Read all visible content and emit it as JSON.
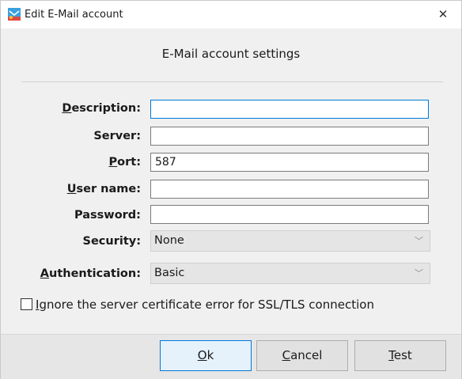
{
  "window": {
    "title": "Edit E-Mail account",
    "close_glyph": "✕",
    "app_icon": "mail-app-icon"
  },
  "heading": "E-Mail account settings",
  "form": {
    "description": {
      "label_u": "D",
      "label_rest": "escription:",
      "value": ""
    },
    "server": {
      "label": "Server:",
      "value": ""
    },
    "port": {
      "label_u": "P",
      "label_rest": "ort:",
      "value": "587"
    },
    "user_name": {
      "label_u": "U",
      "label_rest": "ser name:",
      "value": ""
    },
    "password": {
      "label": "Password:",
      "value": ""
    },
    "security": {
      "label": "Security:",
      "selected": "None"
    },
    "authentication": {
      "label_u": "A",
      "label_rest": "uthentication:",
      "selected": "Basic"
    }
  },
  "checkbox": {
    "label_u": "I",
    "label_rest": "gnore the server certificate error for SSL/TLS connection",
    "checked": false
  },
  "buttons": {
    "ok": {
      "u": "O",
      "rest": "k"
    },
    "cancel": {
      "u": "C",
      "rest": "ancel"
    },
    "test": {
      "u": "T",
      "rest": "est"
    }
  },
  "colors": {
    "accent": "#0078d7",
    "dialog_bg": "#f0f0f0",
    "footer_bg": "#e6e6e6"
  }
}
